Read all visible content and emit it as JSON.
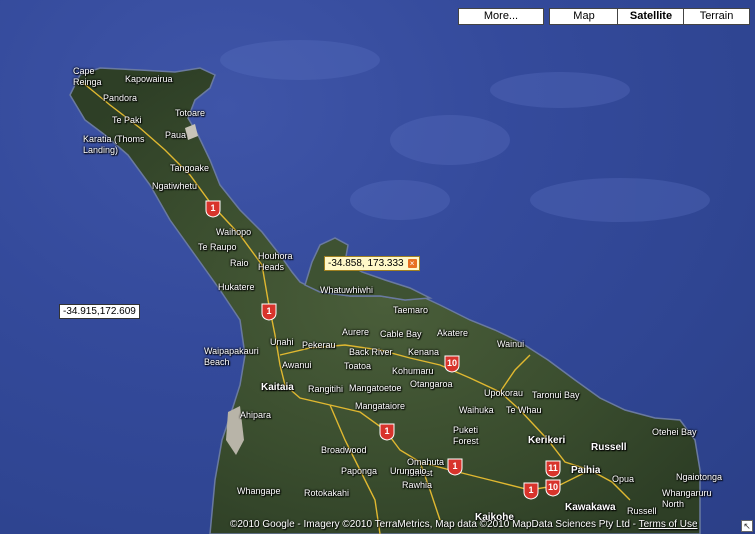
{
  "controls": {
    "more": "More...",
    "map": "Map",
    "satellite": "Satellite",
    "terrain": "Terrain",
    "active": "Satellite"
  },
  "coords": {
    "a": "-34.915,172.609",
    "b": "-34.858, 173.333"
  },
  "places": {
    "cape_reinga": "Cape\nReinga",
    "kapowairua": "Kapowairua",
    "pandora": "Pandora",
    "te_paki": "Te Paki",
    "totoare": "Totoare",
    "paua": "Paua",
    "karatia": "Karatia (Thoms\nLanding)",
    "tangoake": "Tangoake",
    "ngatiwhetu": "Ngatiwhetu",
    "waihopo": "Waihopo",
    "te_raupo": "Te Raupo",
    "houhora": "Houhora\nHeads",
    "raio": "Raio",
    "hukatere": "Hukatere",
    "whatuwhiwhi": "Whatuwhiwhi",
    "taemaro": "Taemaro",
    "aurere": "Aurere",
    "cable_bay": "Cable Bay",
    "akatere": "Akatere",
    "wainui": "Wainui",
    "unahi": "Unahi",
    "pekerau": "Pekerau",
    "back_river": "Back River",
    "kenana": "Kenana",
    "waipapakauri": "Waipapakauri\nBeach",
    "awanui": "Awanui",
    "toatoa": "Toatoa",
    "kohumaru": "Kohumaru",
    "kaitaia": "Kaitaia",
    "rangitihi": "Rangitihi",
    "mangatoetoe": "Mangatoetoe",
    "otangaroa": "Otangaroa",
    "upokorau": "Upokorau",
    "taronui_bay": "Taronui Bay",
    "mangataiore": "Mangataiore",
    "waihuka": "Waihuka",
    "te_whau": "Te Whau",
    "ahipara": "Ahipara",
    "puketi_forest": "Puketi\nForest",
    "kerikeri": "Kerikeri",
    "russell": "Russell",
    "otehei_bay": "Otehei Bay",
    "broadwood": "Broadwood",
    "omahuta_forest": "Omahuta\nForest",
    "paihia": "Paihia",
    "paponga": "Paponga",
    "urungaio": "Urungaio",
    "rawhia": "Rawhia",
    "opua": "Opua",
    "ngaiotonga": "Ngaiotonga",
    "whangape": "Whangape",
    "rotokakahi": "Rotokakahi",
    "kawakawa": "Kawakawa",
    "russell_forest": "Russell",
    "whangaruru": "Whangaruru\nNorth",
    "kaikohe": "Kaikohe"
  },
  "routes": {
    "r1": "1",
    "r10": "10",
    "r11": "11"
  },
  "copyright": {
    "text": "©2010 Google - Imagery ©2010 TerraMetrics, Map data ©2010 MapData Sciences Pty Ltd - ",
    "terms": "Terms of Use"
  },
  "colors": {
    "ocean": "#2f4592",
    "land": "#3d5230",
    "road": "#e0b830",
    "route_shield": "#d8342c"
  }
}
